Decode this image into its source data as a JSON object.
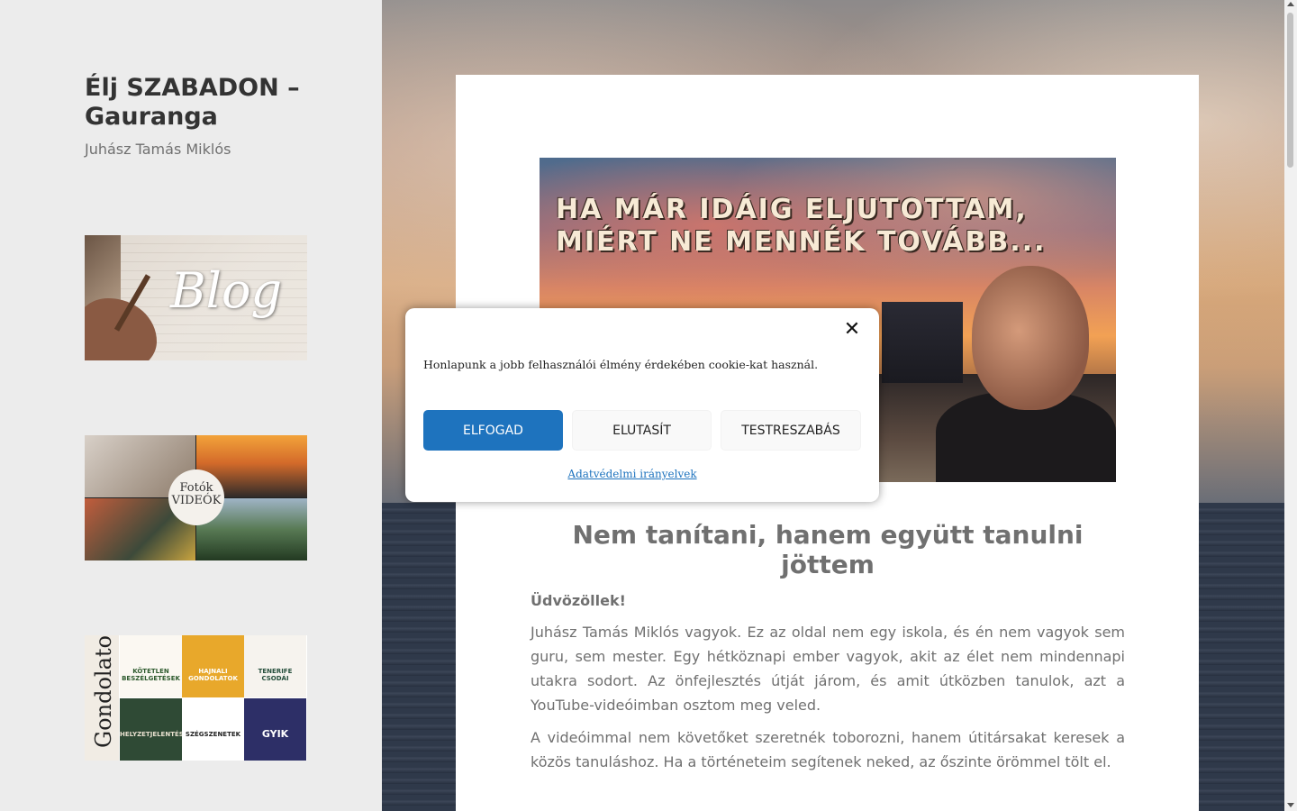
{
  "site": {
    "title": "Élj SZABADON – Gauranga",
    "description": "Juhász Tamás Miklós"
  },
  "sidebar": {
    "widgets": [
      {
        "name": "blog",
        "label": "Blog"
      },
      {
        "name": "photos-videos",
        "label_line1": "Fotók",
        "label_line2": "VIDEÓK"
      },
      {
        "name": "thoughts",
        "label": "Gondolatok",
        "tiles": [
          "KÖTETLEN BESZÉLGETÉSEK",
          "HAJNALI GONDOLATOK",
          "TENERIFE CSODÁI",
          "HELYZETJELENTÉSEK",
          "SZÉGSZENETEK",
          "GYIK"
        ]
      }
    ]
  },
  "article": {
    "hero_line1": "HA MÁR IDÁIG ELJUTOTTAM,",
    "hero_line2": "MIÉRT NE MENNÉK TOVÁBB...",
    "heading": "Nem tanítani, hanem együtt tanulni jöttem",
    "greeting": "Üdvözöllek!",
    "paragraph1": "Juhász Tamás Miklós vagyok. Ez az oldal nem egy iskola, és én nem vagyok sem guru, sem mester. Egy hétköznapi ember vagyok, akit az élet nem mindennapi utakra sodort. Az önfejlesztés útját járom, és amit útközben tanulok, azt a YouTube-videóimban osztom meg veled.",
    "paragraph2": "A videóimmal nem követőket szeretnék toborozni, hanem útitársakat keresek a közös tanuláshoz. Ha a történeteim segítenek neked, az őszinte örömmel tölt el."
  },
  "cookie_banner": {
    "message": "Honlapunk a jobb felhasználói élmény érdekében cookie-kat használ.",
    "accept_label": "ELFOGAD",
    "deny_label": "ELUTASÍT",
    "customize_label": "TESTRESZABÁS",
    "policy_link": "Adatvédelmi irányelvek",
    "close_icon": "close-icon",
    "accent_color": "#1e73be"
  }
}
